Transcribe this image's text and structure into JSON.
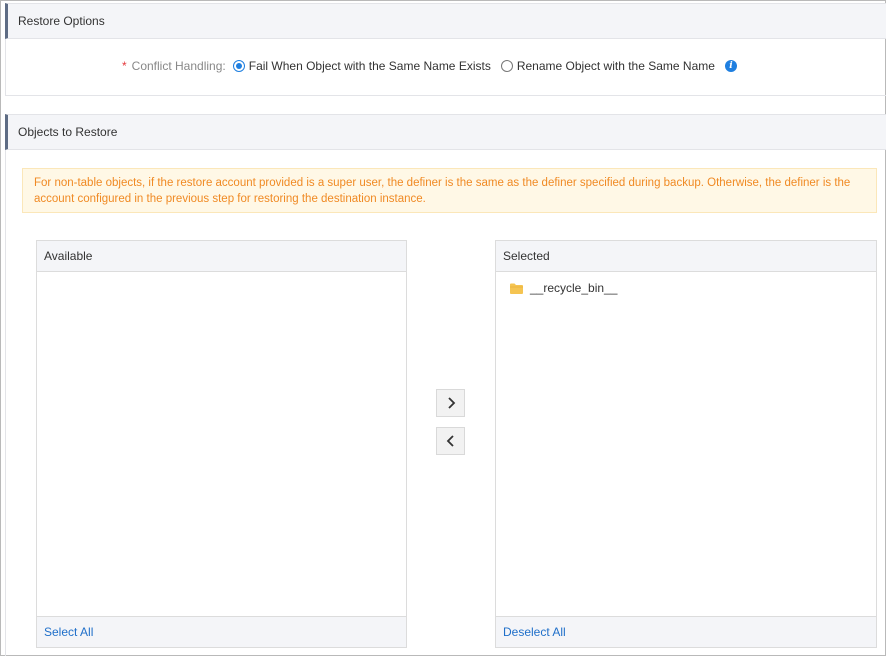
{
  "restore_options": {
    "title": "Restore Options",
    "required_mark": "*",
    "conflict_label": "Conflict Handling:",
    "options": [
      {
        "label": "Fail When Object with the Same Name Exists",
        "checked": true
      },
      {
        "label": "Rename Object with the Same Name",
        "checked": false
      }
    ],
    "info_icon": "info-icon",
    "info_glyph": "i"
  },
  "objects_to_restore": {
    "title": "Objects to Restore",
    "notice": "For non-table objects, if the restore account provided is a super user, the definer is the same as the definer specified during backup. Otherwise, the definer is the account configured in the previous step for restoring the destination instance.",
    "available": {
      "title": "Available",
      "items": [],
      "footer_action": "Select All"
    },
    "selected": {
      "title": "Selected",
      "items": [
        {
          "label": "__recycle_bin__",
          "icon": "folder-icon"
        }
      ],
      "footer_action": "Deselect All"
    },
    "move_right_icon": "chevron-right-icon",
    "move_left_icon": "chevron-left-icon"
  },
  "colors": {
    "accent": "#1f7fe0",
    "link": "#1f6fc9",
    "notice_text": "#f08a24",
    "notice_bg": "#fff8e6",
    "required": "#e4393c",
    "folder": "#f5c451"
  }
}
